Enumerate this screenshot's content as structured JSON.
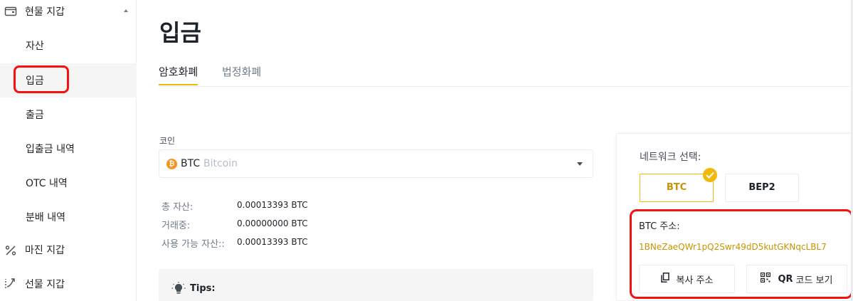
{
  "sidebar": {
    "spot_wallet": "현물 지갑",
    "items": [
      {
        "label": "자산"
      },
      {
        "label": "입금"
      },
      {
        "label": "출금"
      },
      {
        "label": "입출금 내역"
      },
      {
        "label": "OTC 내역"
      },
      {
        "label": "분배 내역"
      }
    ],
    "margin_wallet": "마진 지갑",
    "futures_wallet": "선물 지갑"
  },
  "main": {
    "title": "입금",
    "tabs": [
      {
        "label": "암호화폐",
        "active": true
      },
      {
        "label": "법정화폐",
        "active": false
      }
    ],
    "coin": {
      "label": "코인",
      "symbol": "BTC",
      "name": "Bitcoin",
      "badge": "₿"
    },
    "balances": [
      {
        "label": "총 자산:",
        "value": "0.00013393 BTC"
      },
      {
        "label": "거래중:",
        "value": "0.00000000 BTC"
      },
      {
        "label": "사용 가능 자산::",
        "value": "0.00013393 BTC"
      }
    ],
    "tips_label": "Tips:"
  },
  "panel": {
    "network_label": "네트워크 선택:",
    "networks": [
      {
        "label": "BTC",
        "selected": true
      },
      {
        "label": "BEP2",
        "selected": false
      }
    ],
    "address_label": "BTC 주소:",
    "address": "1BNeZaeQWr1pQ2Swr49dD5kutGKNqcLBL7",
    "copy_label": "복사 주소",
    "qr_bold": "QR",
    "qr_label": "코드 보기"
  },
  "colors": {
    "accent": "#f0b90b",
    "address_text": "#c99400",
    "highlight_annotation": "#f6100e"
  }
}
